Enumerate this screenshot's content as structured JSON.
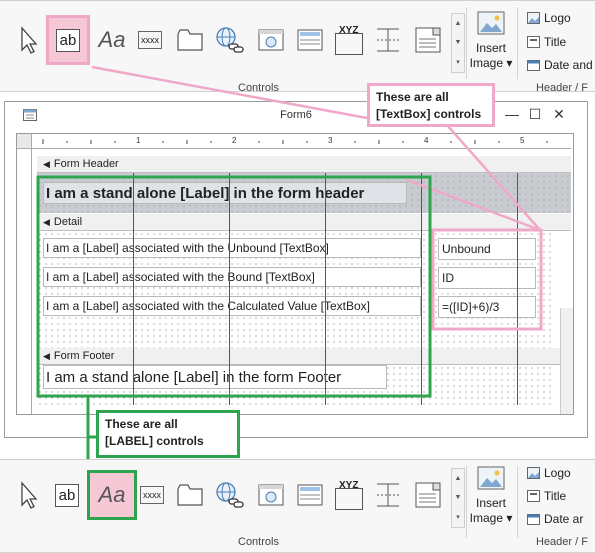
{
  "ribbon_top": {
    "group_controls_label": "Controls",
    "group_header_label": "Header / F",
    "textbox_label": "ab",
    "label_label": "Aa",
    "button_label": "xxxx",
    "xyz_label": "XYZ",
    "insert_image": [
      "Insert",
      "Image"
    ],
    "header_items": [
      "Logo",
      "Title",
      "Date and"
    ]
  },
  "form_window": {
    "title": "Form6",
    "close": "✕",
    "maximize": "☐",
    "minimize": "—",
    "ruler_numbers": [
      "1",
      "2",
      "3",
      "4",
      "5"
    ],
    "sections": {
      "header": "Form Header",
      "detail": "Detail",
      "footer": "Form Footer"
    },
    "header_label": "I am a stand alone [Label] in the  form header",
    "detail_labels": [
      "I am a [Label] associated with the Unbound [TextBox]",
      "I am a [Label] associated with the Bound [TextBox]",
      "I am a [Label] associated with the Calculated Value [TextBox]"
    ],
    "detail_textboxes": [
      "Unbound",
      "ID",
      "=([ID]+6)/3"
    ],
    "footer_label": "I am a stand alone [Label] in the  form Footer"
  },
  "callouts": {
    "textbox": [
      "These are all",
      "[TextBox] controls"
    ],
    "label": [
      "These are all",
      "[LABEL] controls"
    ]
  },
  "ribbon_bottom": {
    "group_controls_label": "Controls",
    "group_header_label": "Header / F",
    "textbox_label": "ab",
    "label_label": "Aa",
    "button_label": "xxxx",
    "xyz_label": "XYZ",
    "insert_image": [
      "Insert",
      "Image"
    ],
    "header_items": [
      "Logo",
      "Title",
      "Date ar"
    ]
  },
  "colors": {
    "pink": "#f0a8c8",
    "green": "#2ea44f",
    "header_fill": "#c8ccd1"
  }
}
